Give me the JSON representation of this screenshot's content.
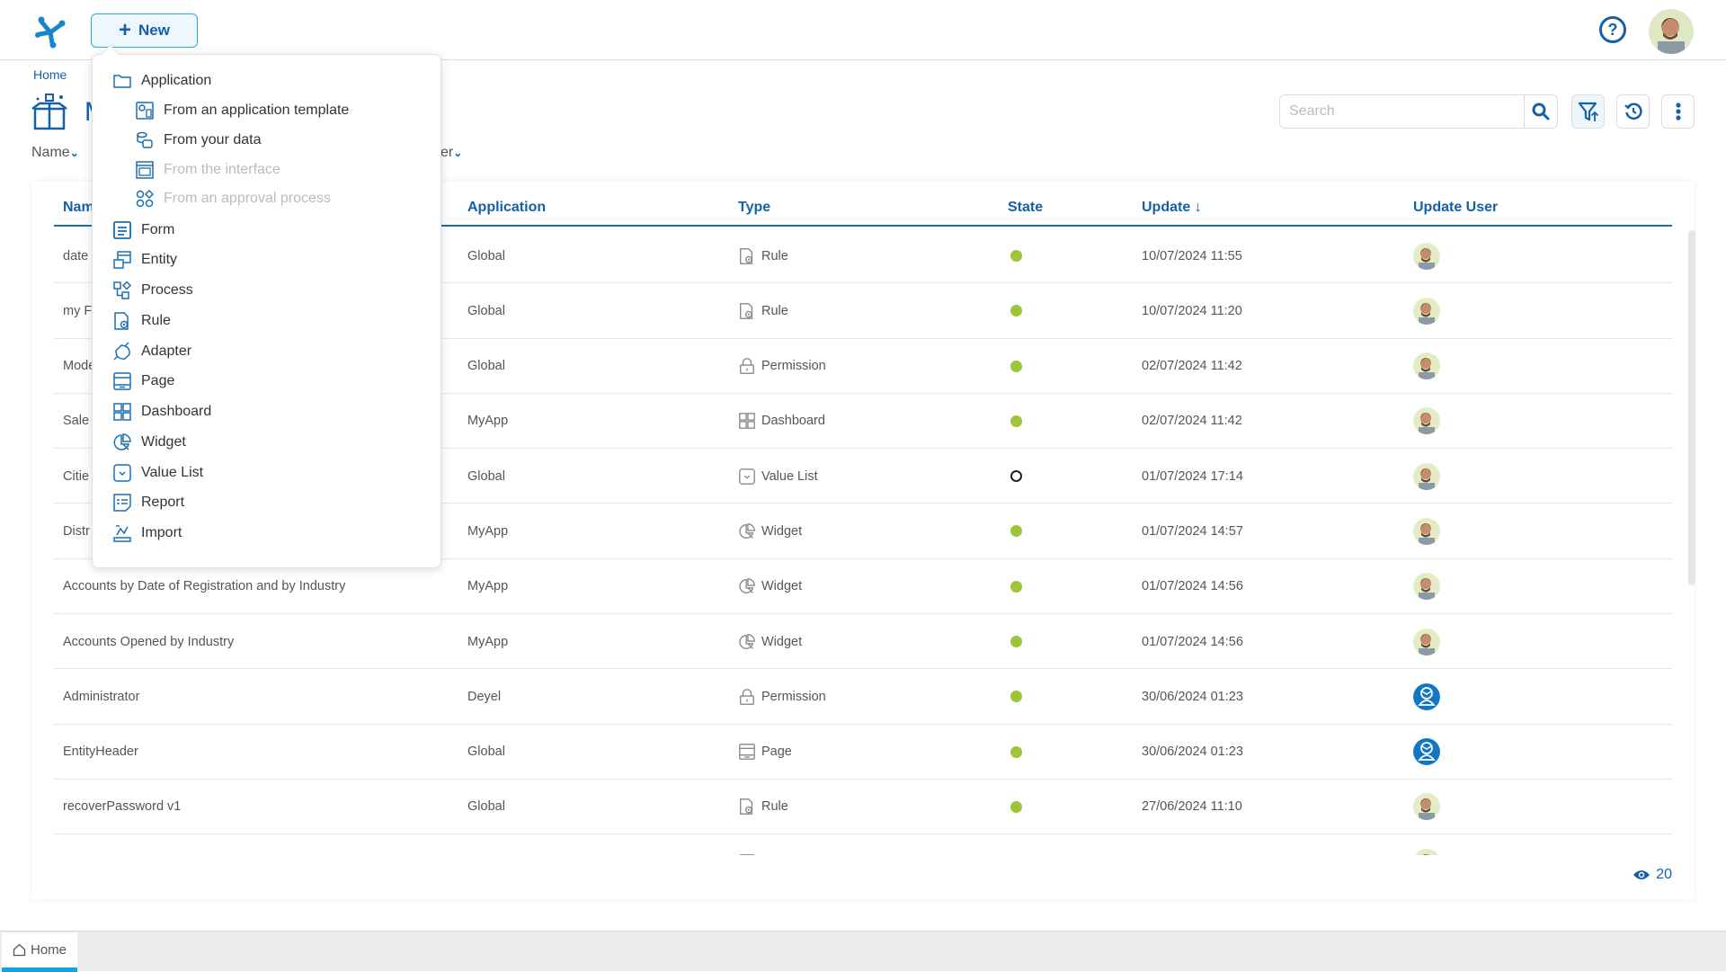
{
  "topbar": {
    "new_button_label": "New",
    "help_icon": "help-circle-icon",
    "user_avatar": "user-photo"
  },
  "breadcrumb": {
    "home": "Home"
  },
  "page": {
    "title_visible": "M",
    "icon": "gift-box-icon"
  },
  "filters": [
    {
      "label": "Name"
    },
    {
      "label": "er"
    }
  ],
  "search": {
    "placeholder": "Search",
    "value": ""
  },
  "toolbar": {
    "filter_icon": "filter-sort-icon",
    "history_icon": "history-icon",
    "more_icon": "more-vertical-icon"
  },
  "menu": {
    "items": [
      {
        "label": "Application",
        "icon": "folder-icon",
        "level": 0,
        "disabled": false
      },
      {
        "label": "From an application template",
        "icon": "template-icon",
        "level": 1,
        "disabled": false
      },
      {
        "label": "From your data",
        "icon": "database-icon",
        "level": 1,
        "disabled": false
      },
      {
        "label": "From the interface",
        "icon": "interface-icon",
        "level": 1,
        "disabled": true
      },
      {
        "label": "From an approval process",
        "icon": "approval-process-icon",
        "level": 1,
        "disabled": true
      },
      {
        "label": "Form",
        "icon": "form-icon",
        "level": 0,
        "disabled": false
      },
      {
        "label": "Entity",
        "icon": "entity-icon",
        "level": 0,
        "disabled": false
      },
      {
        "label": "Process",
        "icon": "process-icon",
        "level": 0,
        "disabled": false
      },
      {
        "label": "Rule",
        "icon": "rule-icon",
        "level": 0,
        "disabled": false
      },
      {
        "label": "Adapter",
        "icon": "adapter-icon",
        "level": 0,
        "disabled": false
      },
      {
        "label": "Page",
        "icon": "page-icon",
        "level": 0,
        "disabled": false
      },
      {
        "label": "Dashboard",
        "icon": "dashboard-icon",
        "level": 0,
        "disabled": false
      },
      {
        "label": "Widget",
        "icon": "widget-icon",
        "level": 0,
        "disabled": false
      },
      {
        "label": "Value List",
        "icon": "value-list-icon",
        "level": 0,
        "disabled": false
      },
      {
        "label": "Report",
        "icon": "report-icon",
        "level": 0,
        "disabled": false
      },
      {
        "label": "Import",
        "icon": "import-icon",
        "level": 0,
        "disabled": false
      }
    ]
  },
  "table": {
    "columns": [
      "Name",
      "Application",
      "Type",
      "State",
      "Update",
      "Update User"
    ],
    "name_header_visible": "Nam",
    "sort_indicator": "↓",
    "rows": [
      {
        "name": "date",
        "application": "Global",
        "type": "Rule",
        "state": "active",
        "update": "10/07/2024 11:55",
        "user": "photo"
      },
      {
        "name": "my F",
        "application": "Global",
        "type": "Rule",
        "state": "active",
        "update": "10/07/2024 11:20",
        "user": "photo"
      },
      {
        "name": "Mode",
        "application": "Global",
        "type": "Permission",
        "state": "active",
        "update": "02/07/2024 11:42",
        "user": "photo"
      },
      {
        "name": "Sale",
        "application": "MyApp",
        "type": "Dashboard",
        "state": "active",
        "update": "02/07/2024 11:42",
        "user": "photo"
      },
      {
        "name": "Citie",
        "application": "Global",
        "type": "Value List",
        "state": "inactive",
        "update": "01/07/2024 17:14",
        "user": "photo"
      },
      {
        "name": "Distr",
        "application": "MyApp",
        "type": "Widget",
        "state": "active",
        "update": "01/07/2024 14:57",
        "user": "photo"
      },
      {
        "name": "Accounts by Date of Registration and by Industry",
        "application": "MyApp",
        "type": "Widget",
        "state": "active",
        "update": "01/07/2024 14:56",
        "user": "photo"
      },
      {
        "name": "Accounts Opened by Industry",
        "application": "MyApp",
        "type": "Widget",
        "state": "active",
        "update": "01/07/2024 14:56",
        "user": "photo"
      },
      {
        "name": "Administrator",
        "application": "Deyel",
        "type": "Permission",
        "state": "active",
        "update": "30/06/2024 01:23",
        "user": "system"
      },
      {
        "name": "EntityHeader",
        "application": "Global",
        "type": "Page",
        "state": "active",
        "update": "30/06/2024 01:23",
        "user": "system"
      },
      {
        "name": "recoverPassword v1",
        "application": "Global",
        "type": "Rule",
        "state": "active",
        "update": "27/06/2024 11:10",
        "user": "photo"
      },
      {
        "name": "",
        "application": "",
        "type": "Page",
        "state": "active",
        "update": "",
        "user": "photo"
      }
    ],
    "visible_count": "20"
  },
  "bottom_tabs": [
    {
      "label": "Home",
      "icon": "home-icon",
      "active": true
    }
  ],
  "colors": {
    "primary": "#1560a8",
    "accent": "#29a8e0",
    "state_active": "#9ec43a",
    "tab_indicator": "#0aa5e6"
  }
}
